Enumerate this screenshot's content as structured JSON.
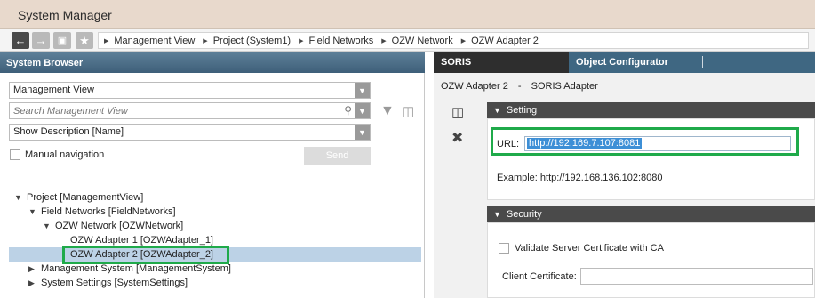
{
  "app": {
    "title": "System Manager"
  },
  "nav": {
    "back_icon": "arrow-left-icon",
    "forward_icon": "arrow-right-icon",
    "home_icon": "home-icon",
    "favorite_icon": "star-icon",
    "breadcrumb": [
      "Management View",
      "Project (System1)",
      "Field Networks",
      "OZW Network",
      "OZW Adapter 2"
    ]
  },
  "system_browser": {
    "header": "System Browser",
    "view_select": "Management View",
    "search_placeholder": "Search Management View",
    "description_select": "Show Description [Name]",
    "manual_navigation_label": "Manual navigation",
    "send_label": "Send",
    "tree": [
      {
        "label": "Project [ManagementView]",
        "expanded": true
      },
      {
        "label": "Field Networks [FieldNetworks]",
        "expanded": true
      },
      {
        "label": "OZW Network [OZWNetwork]",
        "expanded": true
      },
      {
        "label": "OZW Adapter 1 [OZWAdapter_1]"
      },
      {
        "label": "OZW Adapter 2 [OZWAdapter_2]",
        "selected": true
      },
      {
        "label": "Management System [ManagementSystem]",
        "expanded": false
      },
      {
        "label": "System Settings [SystemSettings]",
        "expanded": false
      }
    ]
  },
  "detail": {
    "tabs": [
      "SORIS",
      "Object Configurator"
    ],
    "object_name": "OZW Adapter 2",
    "object_separator": "-",
    "object_type": "SORIS Adapter",
    "setting": {
      "header": "Setting",
      "url_label": "URL:",
      "url_value": "http://192.169.7.107:8081",
      "example": "Example: http://192.168.136.102:8080"
    },
    "security": {
      "header": "Security",
      "validate_label": "Validate Server Certificate with CA",
      "client_cert_label": "Client Certificate:"
    }
  },
  "colors": {
    "title_bar": "#e8d9cc",
    "panel_header": "#4b6c86",
    "highlight": "#1faa4a",
    "selection": "#bcd2e6"
  }
}
